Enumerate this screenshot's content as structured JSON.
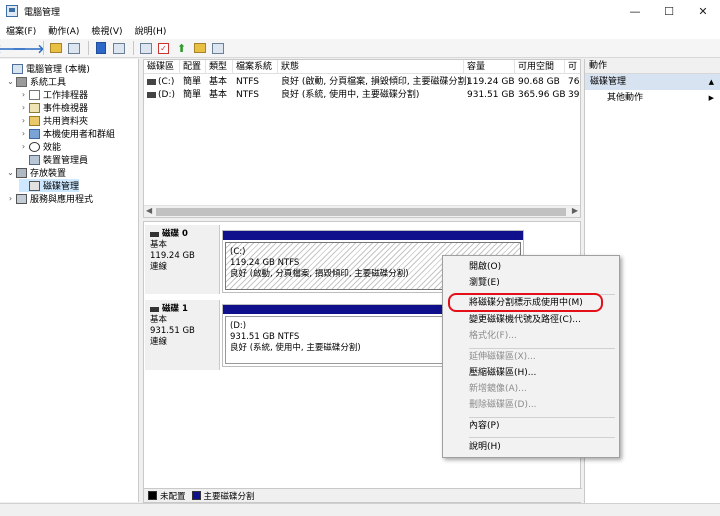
{
  "window": {
    "title": "電腦管理",
    "controls": {
      "minimize": "—",
      "maximize": "☐",
      "close": "✕"
    }
  },
  "menu": [
    "檔案(F)",
    "動作(A)",
    "檢視(V)",
    "說明(H)"
  ],
  "toolbar": {
    "icons": [
      "back-arrow-icon",
      "forward-arrow-icon",
      "folder-up-icon",
      "console-tree-icon",
      "help-icon",
      "properties-icon",
      "key-icon",
      "check-icon",
      "upload-icon",
      "search-icon",
      "view-icon"
    ]
  },
  "tree": {
    "items": [
      {
        "label": "電腦管理 (本機)",
        "icon": "computer-management-icon",
        "expander": ""
      },
      {
        "label": "系統工具",
        "icon": "tools-icon",
        "expander": "⌄"
      },
      {
        "label": "工作排程器",
        "icon": "task-scheduler-icon",
        "expander": "›"
      },
      {
        "label": "事件檢視器",
        "icon": "event-viewer-icon",
        "expander": "›"
      },
      {
        "label": "共用資料夾",
        "icon": "shared-folders-icon",
        "expander": "›"
      },
      {
        "label": "本機使用者和群組",
        "icon": "users-groups-icon",
        "expander": "›"
      },
      {
        "label": "效能",
        "icon": "performance-icon",
        "expander": "›"
      },
      {
        "label": "裝置管理員",
        "icon": "device-manager-icon",
        "expander": ""
      },
      {
        "label": "存放裝置",
        "icon": "storage-icon",
        "expander": "⌄"
      },
      {
        "label": "磁碟管理",
        "icon": "disk-management-icon",
        "expander": ""
      },
      {
        "label": "服務與應用程式",
        "icon": "services-icon",
        "expander": "›"
      }
    ]
  },
  "volumes": {
    "columns": [
      "磁碟區",
      "配置",
      "類型",
      "檔案系統",
      "狀態",
      "容量",
      "可用空間",
      "可"
    ],
    "rows": [
      [
        "(C:)",
        "簡單",
        "基本",
        "NTFS",
        "良好 (啟動, 分頁檔案, 損毀傾印, 主要磁碟分割)",
        "119.24 GB",
        "90.68 GB",
        "76"
      ],
      [
        "(D:)",
        "簡單",
        "基本",
        "NTFS",
        "良好 (系統, 使用中, 主要磁碟分割)",
        "931.51 GB",
        "365.96 GB",
        "39"
      ]
    ]
  },
  "disks": [
    {
      "name": "磁碟 0",
      "type": "基本",
      "size": "119.24 GB",
      "status": "連線",
      "partition": {
        "letter": "(C:)",
        "size_fs": "119.24 GB NTFS",
        "status": "良好 (啟動, 分頁檔案, 損毀傾印, 主要磁碟分割)"
      }
    },
    {
      "name": "磁碟 1",
      "type": "基本",
      "size": "931.51 GB",
      "status": "連線",
      "partition": {
        "letter": "(D:)",
        "size_fs": "931.51 GB NTFS",
        "status": "良好 (系統, 使用中, 主要磁碟分割)"
      }
    }
  ],
  "legend": {
    "unallocated": "未配置",
    "primary": "主要磁碟分割",
    "colors": {
      "unallocated": "#000000",
      "primary": "#10108c"
    }
  },
  "actions": {
    "header": "動作",
    "section": "磁碟管理",
    "item": "其他動作",
    "arrow_up": "▲",
    "arrow_right": "▶"
  },
  "context_menu": {
    "items": [
      {
        "label": "開啟(O)",
        "disabled": false
      },
      {
        "label": "瀏覽(E)",
        "disabled": false
      },
      {
        "label": "將磁碟分割標示成使用中(M)",
        "disabled": false
      },
      {
        "label": "變更磁碟機代號及路徑(C)...",
        "disabled": false
      },
      {
        "label": "格式化(F)...",
        "disabled": true
      },
      {
        "label": "延伸磁碟區(X)...",
        "disabled": true
      },
      {
        "label": "壓縮磁碟區(H)...",
        "disabled": false
      },
      {
        "label": "新增鏡像(A)...",
        "disabled": true
      },
      {
        "label": "刪除磁碟區(D)...",
        "disabled": true
      },
      {
        "label": "內容(P)",
        "disabled": false
      },
      {
        "label": "說明(H)",
        "disabled": false
      }
    ],
    "highlight_color": "#e3101a"
  }
}
